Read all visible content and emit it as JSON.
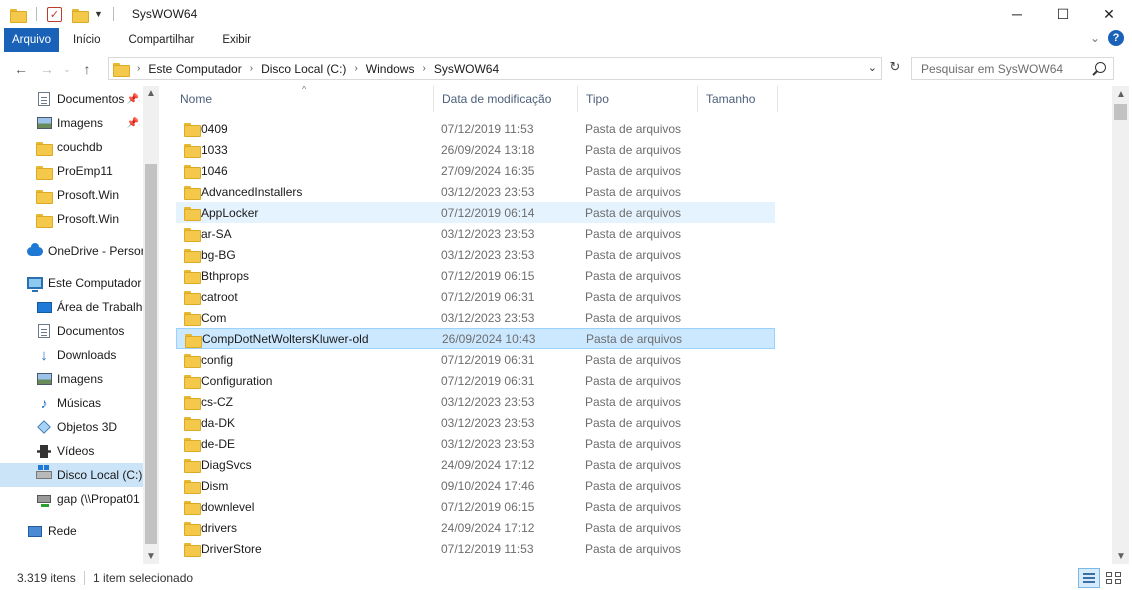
{
  "window": {
    "title": "SysWOW64",
    "controls": [
      "─",
      "☐",
      "✕"
    ]
  },
  "ribbon": {
    "tabs": [
      "Arquivo",
      "Início",
      "Compartilhar",
      "Exibir"
    ]
  },
  "address": {
    "crumbs": [
      "Este Computador",
      "Disco Local (C:)",
      "Windows",
      "SysWOW64"
    ]
  },
  "search": {
    "placeholder": "Pesquisar em SysWOW64"
  },
  "nav": {
    "items": [
      {
        "label": "Documentos",
        "icon": "document-icon",
        "pinned": true
      },
      {
        "label": "Imagens",
        "icon": "image-icon",
        "pinned": true
      },
      {
        "label": "couchdb",
        "icon": "folder-icon"
      },
      {
        "label": "ProEmp11",
        "icon": "folder-icon"
      },
      {
        "label": "Prosoft.Win",
        "icon": "folder-icon"
      },
      {
        "label": "Prosoft.Win",
        "icon": "folder-icon"
      },
      {
        "label": "OneDrive - Persor",
        "icon": "onedrive-icon"
      },
      {
        "label": "Este Computador",
        "icon": "computer-icon"
      },
      {
        "label": "Área de Trabalho",
        "icon": "desktop-icon"
      },
      {
        "label": "Documentos",
        "icon": "document-icon"
      },
      {
        "label": "Downloads",
        "icon": "download-icon"
      },
      {
        "label": "Imagens",
        "icon": "image-icon"
      },
      {
        "label": "Músicas",
        "icon": "music-icon"
      },
      {
        "label": "Objetos 3D",
        "icon": "objects3d-icon"
      },
      {
        "label": "Vídeos",
        "icon": "video-icon"
      },
      {
        "label": "Disco Local (C:)",
        "icon": "local-disk-icon",
        "selected": true
      },
      {
        "label": "gap (\\\\Propat01",
        "icon": "network-drive-icon"
      },
      {
        "label": "Rede",
        "icon": "network-icon"
      }
    ]
  },
  "columns": {
    "name": "Nome",
    "date": "Data de modificação",
    "type": "Tipo",
    "size": "Tamanho"
  },
  "files": [
    {
      "name": "0409",
      "date": "07/12/2019 11:53",
      "type": "Pasta de arquivos"
    },
    {
      "name": "1033",
      "date": "26/09/2024 13:18",
      "type": "Pasta de arquivos"
    },
    {
      "name": "1046",
      "date": "27/09/2024 16:35",
      "type": "Pasta de arquivos"
    },
    {
      "name": "AdvancedInstallers",
      "date": "03/12/2023 23:53",
      "type": "Pasta de arquivos"
    },
    {
      "name": "AppLocker",
      "date": "07/12/2019 06:14",
      "type": "Pasta de arquivos",
      "state": "hover"
    },
    {
      "name": "ar-SA",
      "date": "03/12/2023 23:53",
      "type": "Pasta de arquivos"
    },
    {
      "name": "bg-BG",
      "date": "03/12/2023 23:53",
      "type": "Pasta de arquivos"
    },
    {
      "name": "Bthprops",
      "date": "07/12/2019 06:15",
      "type": "Pasta de arquivos"
    },
    {
      "name": "catroot",
      "date": "07/12/2019 06:31",
      "type": "Pasta de arquivos"
    },
    {
      "name": "Com",
      "date": "03/12/2023 23:53",
      "type": "Pasta de arquivos"
    },
    {
      "name": "CompDotNetWoltersKluwer-old",
      "date": "26/09/2024 10:43",
      "type": "Pasta de arquivos",
      "state": "selected"
    },
    {
      "name": "config",
      "date": "07/12/2019 06:31",
      "type": "Pasta de arquivos"
    },
    {
      "name": "Configuration",
      "date": "07/12/2019 06:31",
      "type": "Pasta de arquivos"
    },
    {
      "name": "cs-CZ",
      "date": "03/12/2023 23:53",
      "type": "Pasta de arquivos"
    },
    {
      "name": "da-DK",
      "date": "03/12/2023 23:53",
      "type": "Pasta de arquivos"
    },
    {
      "name": "de-DE",
      "date": "03/12/2023 23:53",
      "type": "Pasta de arquivos"
    },
    {
      "name": "DiagSvcs",
      "date": "24/09/2024 17:12",
      "type": "Pasta de arquivos"
    },
    {
      "name": "Dism",
      "date": "09/10/2024 17:46",
      "type": "Pasta de arquivos"
    },
    {
      "name": "downlevel",
      "date": "07/12/2019 06:15",
      "type": "Pasta de arquivos"
    },
    {
      "name": "drivers",
      "date": "24/09/2024 17:12",
      "type": "Pasta de arquivos"
    },
    {
      "name": "DriverStore",
      "date": "07/12/2019 11:53",
      "type": "Pasta de arquivos"
    }
  ],
  "status": {
    "count": "3.319 itens",
    "selected": "1 item selecionado"
  }
}
